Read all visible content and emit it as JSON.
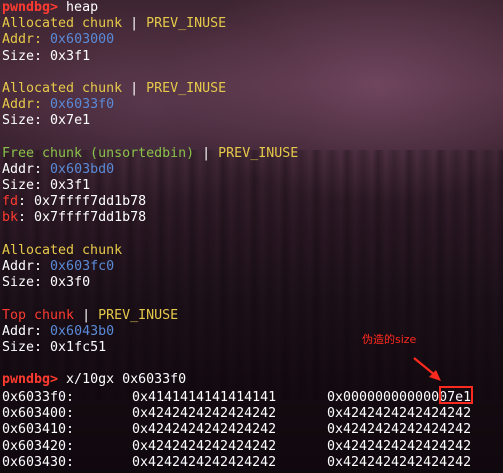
{
  "terminal": {
    "prompt": "pwndbg>",
    "command1": " heap",
    "chunks": [
      {
        "type": "Allocated chunk",
        "sep": " | ",
        "flag": "PREV_INUSE",
        "addr_label": "Addr: ",
        "addr": "0x603000",
        "size_label": "Size: ",
        "size": "0x3f1"
      },
      {
        "type": "Allocated chunk",
        "sep": " | ",
        "flag": "PREV_INUSE",
        "addr_label": "Addr: ",
        "addr": "0x6033f0",
        "size_label": "Size: ",
        "size": "0x7e1"
      },
      {
        "type": "Free chunk (unsortedbin)",
        "sep": " | ",
        "flag": "PREV_INUSE",
        "addr_label": "Addr: ",
        "addr": "0x603bd0",
        "size_label": "Size: ",
        "size": "0x3f1",
        "fd_label": "fd",
        "fd": ": 0x7ffff7dd1b78",
        "bk_label": "bk",
        "bk": ": 0x7ffff7dd1b78"
      },
      {
        "type": "Allocated chunk",
        "addr_label": "Addr: ",
        "addr": "0x603fc0",
        "size_label": "Size: ",
        "size": "0x3f0"
      },
      {
        "type": "Top chunk",
        "sep": " | ",
        "flag": "PREV_INUSE",
        "addr_label": "Addr: ",
        "addr": "0x6043b0",
        "size_label": "Size: ",
        "size": "0x1fc51"
      }
    ],
    "command2": " x/10gx 0x6033f0",
    "memory_rows": [
      {
        "addr": "0x6033f0:",
        "q1": "0x4141414141414141",
        "q2": "0x000000000000",
        "q2_tail": "07e1"
      },
      {
        "addr": "0x603400:",
        "q1": "0x4242424242424242",
        "q2": "0x4242424242424242",
        "q2_tail": ""
      },
      {
        "addr": "0x603410:",
        "q1": "0x4242424242424242",
        "q2": "0x4242424242424242",
        "q2_tail": ""
      },
      {
        "addr": "0x603420:",
        "q1": "0x4242424242424242",
        "q2": "0x4242424242424242",
        "q2_tail": ""
      },
      {
        "addr": "0x603430:",
        "q1": "0x4242424242424242",
        "q2": "0x4242424242424242",
        "q2_tail": ""
      }
    ]
  },
  "annotation": {
    "label": "伪造的size",
    "color": "#ff2a1f"
  },
  "colors": {
    "prompt": "#ff3b30",
    "allocated": "#e6c94a",
    "free": "#8ac24a",
    "top": "#ff3b30",
    "address": "#5a8ad8"
  }
}
